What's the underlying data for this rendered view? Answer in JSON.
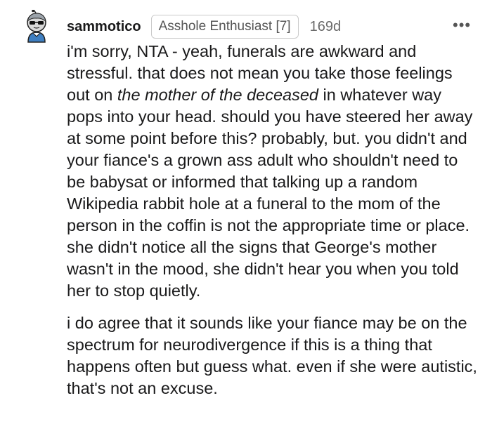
{
  "comment": {
    "username": "sammotico",
    "flair": "Asshole Enthusiast [7]",
    "age": "169d",
    "more_icon": "more-dots-icon",
    "avatar_icon": "avatar-snoo-icon",
    "paragraph1": {
      "part1": "i'm sorry, NTA - yeah, funerals are awkward and stressful. that does not mean you take those feelings out on ",
      "emphasis": "the mother of the deceased",
      "part2": " in whatever way pops into your head. should you have steered her away at some point before this? probably, but. you didn't and your fiance's a grown ass adult who shouldn't need to be babysat or informed that talking up a random Wikipedia rabbit hole at a funeral to the mom of the person in the coffin is not the appropriate time or place. she didn't notice all the signs that George's mother wasn't in the mood, she didn't hear you when you told her to stop quietly."
    },
    "paragraph2": "i do agree that it sounds like your fiance may be on the spectrum for neurodivergence if this is a thing that happens often but guess what. even if she were autistic, that's not an excuse."
  }
}
